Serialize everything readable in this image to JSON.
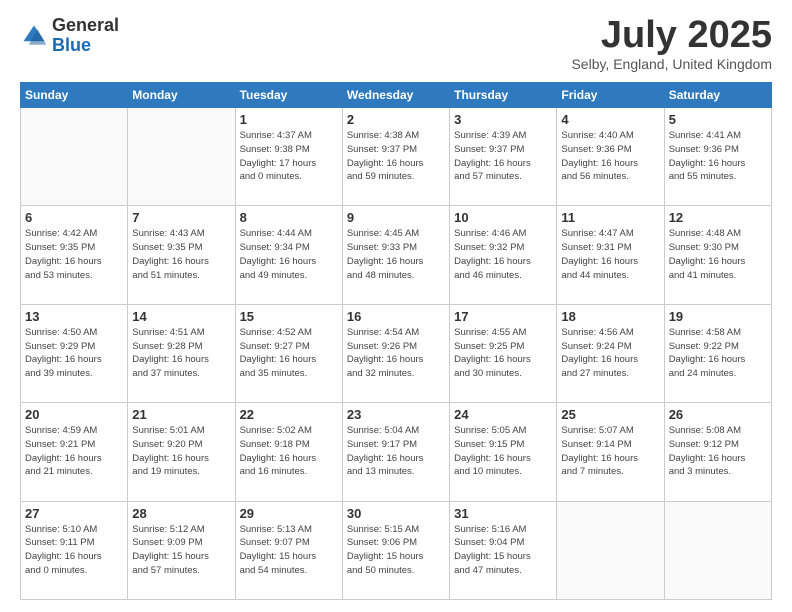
{
  "header": {
    "logo_general": "General",
    "logo_blue": "Blue",
    "month_title": "July 2025",
    "location": "Selby, England, United Kingdom"
  },
  "weekdays": [
    "Sunday",
    "Monday",
    "Tuesday",
    "Wednesday",
    "Thursday",
    "Friday",
    "Saturday"
  ],
  "weeks": [
    [
      {
        "day": "",
        "info": ""
      },
      {
        "day": "",
        "info": ""
      },
      {
        "day": "1",
        "info": "Sunrise: 4:37 AM\nSunset: 9:38 PM\nDaylight: 17 hours\nand 0 minutes."
      },
      {
        "day": "2",
        "info": "Sunrise: 4:38 AM\nSunset: 9:37 PM\nDaylight: 16 hours\nand 59 minutes."
      },
      {
        "day": "3",
        "info": "Sunrise: 4:39 AM\nSunset: 9:37 PM\nDaylight: 16 hours\nand 57 minutes."
      },
      {
        "day": "4",
        "info": "Sunrise: 4:40 AM\nSunset: 9:36 PM\nDaylight: 16 hours\nand 56 minutes."
      },
      {
        "day": "5",
        "info": "Sunrise: 4:41 AM\nSunset: 9:36 PM\nDaylight: 16 hours\nand 55 minutes."
      }
    ],
    [
      {
        "day": "6",
        "info": "Sunrise: 4:42 AM\nSunset: 9:35 PM\nDaylight: 16 hours\nand 53 minutes."
      },
      {
        "day": "7",
        "info": "Sunrise: 4:43 AM\nSunset: 9:35 PM\nDaylight: 16 hours\nand 51 minutes."
      },
      {
        "day": "8",
        "info": "Sunrise: 4:44 AM\nSunset: 9:34 PM\nDaylight: 16 hours\nand 49 minutes."
      },
      {
        "day": "9",
        "info": "Sunrise: 4:45 AM\nSunset: 9:33 PM\nDaylight: 16 hours\nand 48 minutes."
      },
      {
        "day": "10",
        "info": "Sunrise: 4:46 AM\nSunset: 9:32 PM\nDaylight: 16 hours\nand 46 minutes."
      },
      {
        "day": "11",
        "info": "Sunrise: 4:47 AM\nSunset: 9:31 PM\nDaylight: 16 hours\nand 44 minutes."
      },
      {
        "day": "12",
        "info": "Sunrise: 4:48 AM\nSunset: 9:30 PM\nDaylight: 16 hours\nand 41 minutes."
      }
    ],
    [
      {
        "day": "13",
        "info": "Sunrise: 4:50 AM\nSunset: 9:29 PM\nDaylight: 16 hours\nand 39 minutes."
      },
      {
        "day": "14",
        "info": "Sunrise: 4:51 AM\nSunset: 9:28 PM\nDaylight: 16 hours\nand 37 minutes."
      },
      {
        "day": "15",
        "info": "Sunrise: 4:52 AM\nSunset: 9:27 PM\nDaylight: 16 hours\nand 35 minutes."
      },
      {
        "day": "16",
        "info": "Sunrise: 4:54 AM\nSunset: 9:26 PM\nDaylight: 16 hours\nand 32 minutes."
      },
      {
        "day": "17",
        "info": "Sunrise: 4:55 AM\nSunset: 9:25 PM\nDaylight: 16 hours\nand 30 minutes."
      },
      {
        "day": "18",
        "info": "Sunrise: 4:56 AM\nSunset: 9:24 PM\nDaylight: 16 hours\nand 27 minutes."
      },
      {
        "day": "19",
        "info": "Sunrise: 4:58 AM\nSunset: 9:22 PM\nDaylight: 16 hours\nand 24 minutes."
      }
    ],
    [
      {
        "day": "20",
        "info": "Sunrise: 4:59 AM\nSunset: 9:21 PM\nDaylight: 16 hours\nand 21 minutes."
      },
      {
        "day": "21",
        "info": "Sunrise: 5:01 AM\nSunset: 9:20 PM\nDaylight: 16 hours\nand 19 minutes."
      },
      {
        "day": "22",
        "info": "Sunrise: 5:02 AM\nSunset: 9:18 PM\nDaylight: 16 hours\nand 16 minutes."
      },
      {
        "day": "23",
        "info": "Sunrise: 5:04 AM\nSunset: 9:17 PM\nDaylight: 16 hours\nand 13 minutes."
      },
      {
        "day": "24",
        "info": "Sunrise: 5:05 AM\nSunset: 9:15 PM\nDaylight: 16 hours\nand 10 minutes."
      },
      {
        "day": "25",
        "info": "Sunrise: 5:07 AM\nSunset: 9:14 PM\nDaylight: 16 hours\nand 7 minutes."
      },
      {
        "day": "26",
        "info": "Sunrise: 5:08 AM\nSunset: 9:12 PM\nDaylight: 16 hours\nand 3 minutes."
      }
    ],
    [
      {
        "day": "27",
        "info": "Sunrise: 5:10 AM\nSunset: 9:11 PM\nDaylight: 16 hours\nand 0 minutes."
      },
      {
        "day": "28",
        "info": "Sunrise: 5:12 AM\nSunset: 9:09 PM\nDaylight: 15 hours\nand 57 minutes."
      },
      {
        "day": "29",
        "info": "Sunrise: 5:13 AM\nSunset: 9:07 PM\nDaylight: 15 hours\nand 54 minutes."
      },
      {
        "day": "30",
        "info": "Sunrise: 5:15 AM\nSunset: 9:06 PM\nDaylight: 15 hours\nand 50 minutes."
      },
      {
        "day": "31",
        "info": "Sunrise: 5:16 AM\nSunset: 9:04 PM\nDaylight: 15 hours\nand 47 minutes."
      },
      {
        "day": "",
        "info": ""
      },
      {
        "day": "",
        "info": ""
      }
    ]
  ]
}
